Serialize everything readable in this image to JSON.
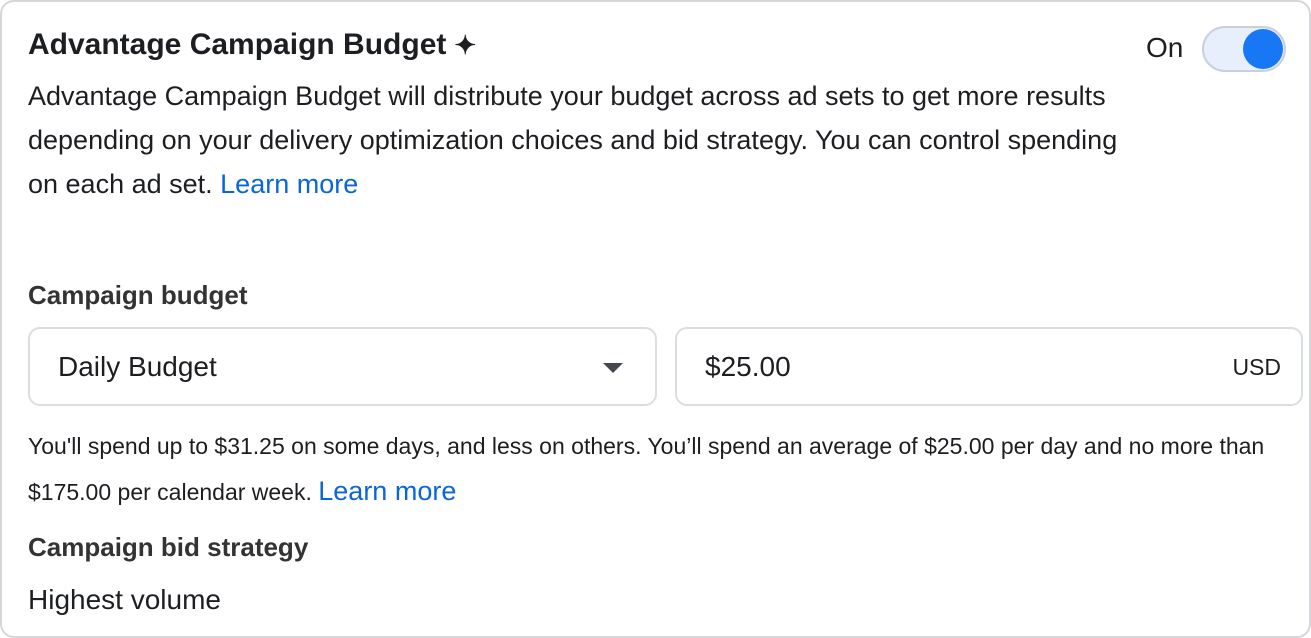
{
  "header": {
    "title": "Advantage Campaign Budget",
    "sparkle_icon": "sparkle-icon",
    "toggle_label": "On",
    "toggle_on": true
  },
  "description": {
    "text": "Advantage Campaign Budget will distribute your budget across ad sets to get more results depending on your delivery optimization choices and bid strategy. You can control spending on each ad set.",
    "link": "Learn more"
  },
  "budget": {
    "label": "Campaign budget",
    "type_selected": "Daily Budget",
    "amount": "$25.00",
    "currency": "USD",
    "help": "You'll spend up to $31.25 on some days, and less on others. You’ll spend an average of $25.00 per day and no more than $175.00 per calendar week.",
    "help_link": "Learn more"
  },
  "bid": {
    "label": "Campaign bid strategy",
    "value": "Highest volume"
  },
  "colors": {
    "accent": "#1877f2",
    "link": "#0a66d8"
  }
}
